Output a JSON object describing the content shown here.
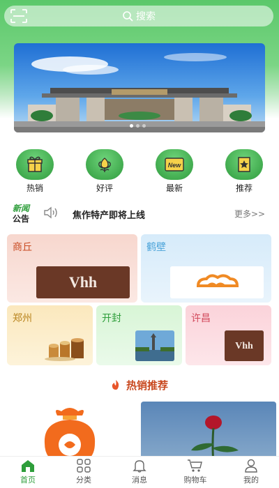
{
  "colors": {
    "brand_green": "#2e9e3b",
    "header_green": "#5bc86a",
    "hot_orange": "#c94a21"
  },
  "header": {
    "search_label": "搜索",
    "scan_icon": "scan-icon"
  },
  "quick_links": [
    {
      "label": "热销",
      "icon": "gift-icon"
    },
    {
      "label": "好评",
      "icon": "flower-icon"
    },
    {
      "label": "最新",
      "icon": "new-badge-icon"
    },
    {
      "label": "推荐",
      "icon": "star-bookmark-icon"
    }
  ],
  "new_badge_text": "New",
  "notice": {
    "tag_top": "新闻",
    "tag_bottom": "公告",
    "text": "焦作特产即将上线",
    "more": "更多>>"
  },
  "regions": [
    {
      "name": "商丘",
      "color": "#c94a21"
    },
    {
      "name": "鹤壁",
      "color": "#4aa3d9"
    },
    {
      "name": "郑州",
      "color": "#b8831c"
    },
    {
      "name": "开封",
      "color": "#2e9e3b"
    },
    {
      "name": "许昌",
      "color": "#d24a5c"
    }
  ],
  "brand_logo_text": "Vhh",
  "section": {
    "title": "热销推荐"
  },
  "tabbar": [
    {
      "label": "首页",
      "icon": "home-icon",
      "active": true
    },
    {
      "label": "分类",
      "icon": "category-grid-icon",
      "active": false
    },
    {
      "label": "消息",
      "icon": "bell-icon",
      "active": false
    },
    {
      "label": "购物车",
      "icon": "cart-icon",
      "active": false
    },
    {
      "label": "我的",
      "icon": "user-icon",
      "active": false
    }
  ]
}
